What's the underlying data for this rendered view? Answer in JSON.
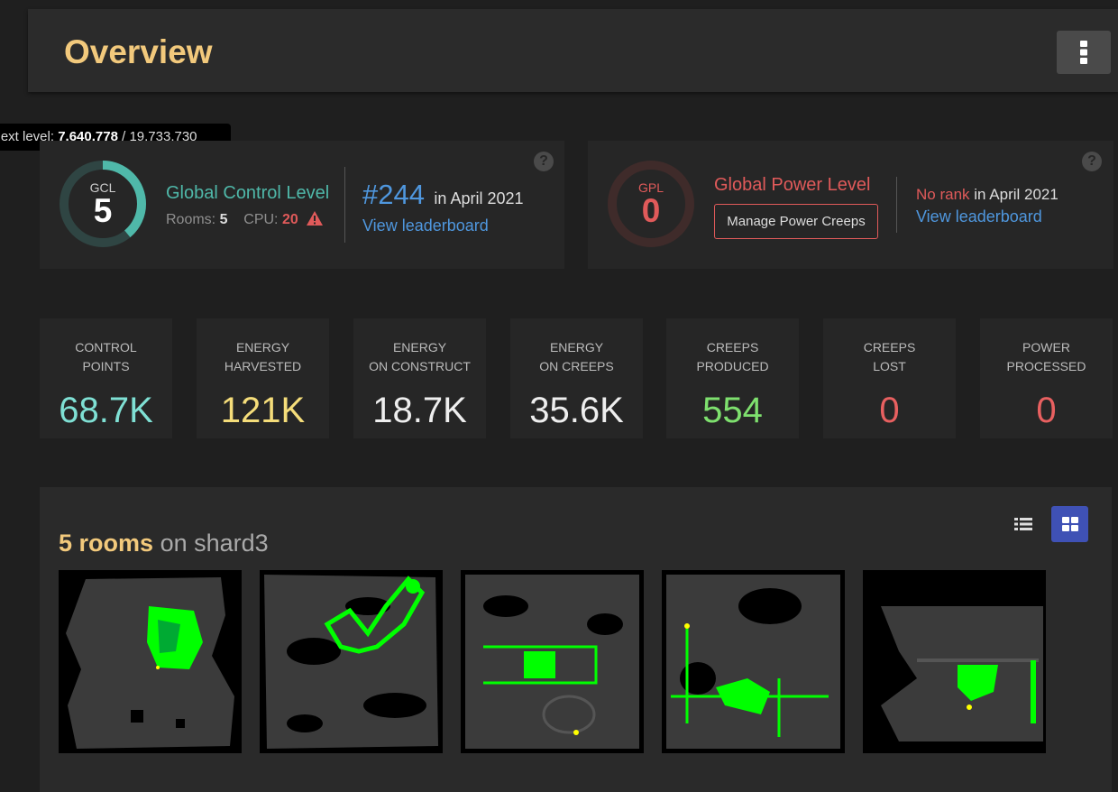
{
  "header": {
    "title": "Overview",
    "menu_icon": "vertical-dots-icon"
  },
  "tooltip": {
    "prefix": "Next level:",
    "current": "7,640,778",
    "separator": "/",
    "total": "19,733,730"
  },
  "gcl": {
    "ring_label": "GCL",
    "level": "5",
    "progress": 0.39,
    "title": "Global Control Level",
    "rooms_label": "Rooms:",
    "rooms_value": "5",
    "cpu_label": "CPU:",
    "cpu_value": "20",
    "rank": "#244",
    "rank_period": "in April 2021",
    "leaderboard_link": "View leaderboard",
    "accent_color": "#4fb8a9",
    "warning_color": "#e05a5a"
  },
  "gpl": {
    "ring_label": "GPL",
    "level": "0",
    "title": "Global Power Level",
    "button_label": "Manage Power Creeps",
    "rank_status": "No rank",
    "rank_period": "in April 2021",
    "leaderboard_link": "View leaderboard",
    "accent_color": "#e05a5a"
  },
  "stats": [
    {
      "label": "CONTROL\nPOINTS",
      "value": "68.7K",
      "color": "#7fe0d4"
    },
    {
      "label": "ENERGY\nHARVESTED",
      "value": "121K",
      "color": "#f5dd7a"
    },
    {
      "label": "ENERGY\nON CONSTRUCT",
      "value": "18.7K",
      "color": "#eeeeee"
    },
    {
      "label": "ENERGY\nON CREEPS",
      "value": "35.6K",
      "color": "#eeeeee"
    },
    {
      "label": "CREEPS\nPRODUCED",
      "value": "554",
      "color": "#7ee06e"
    },
    {
      "label": "CREEPS\nLOST",
      "value": "0",
      "color": "#e86060"
    },
    {
      "label": "POWER\nPROCESSED",
      "value": "0",
      "color": "#e86060"
    }
  ],
  "rooms": {
    "count_text": "5 rooms",
    "shard_text": "on shard3",
    "list_view_icon": "list-view-icon",
    "grid_view_icon": "grid-view-icon",
    "active_view": "grid",
    "thumbnails": 5
  }
}
